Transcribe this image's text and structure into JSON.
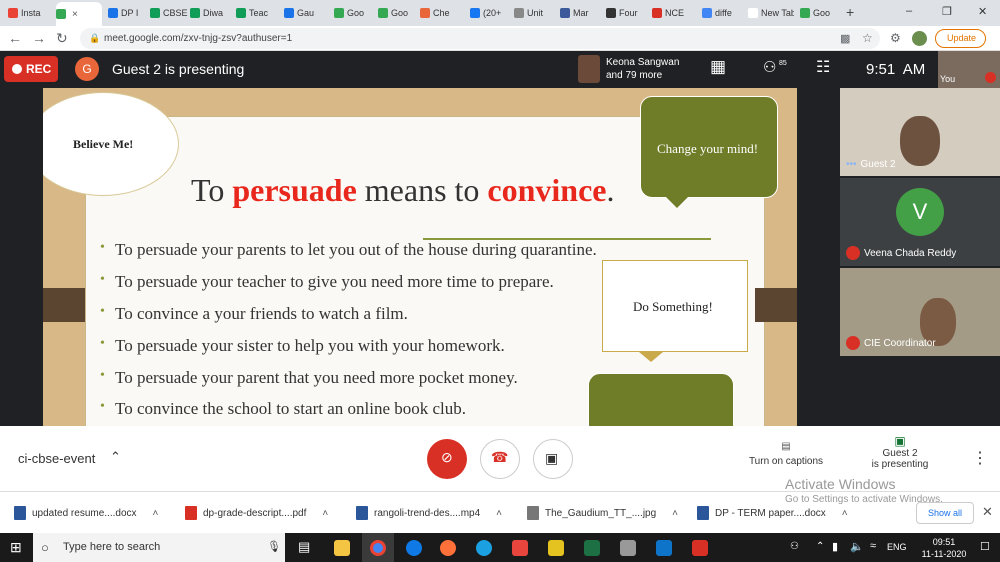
{
  "browser": {
    "tabs": [
      {
        "label": "Insta",
        "color": "#ea4335"
      },
      {
        "label": "",
        "color": "#34a853"
      },
      {
        "label": "DP I",
        "color": "#1a73e8"
      },
      {
        "label": "CBSE",
        "color": "#0f9d58"
      },
      {
        "label": "Diwa",
        "color": "#0f9d58"
      },
      {
        "label": "Teac",
        "color": "#0f9d58"
      },
      {
        "label": "Gau",
        "color": "#1a73e8"
      },
      {
        "label": "Goo",
        "color": "#34a853"
      },
      {
        "label": "Goo",
        "color": "#34a853"
      },
      {
        "label": "Che",
        "color": "#e8663a"
      },
      {
        "label": "(20+",
        "color": "#1877f2"
      },
      {
        "label": "Unit",
        "color": "#888888"
      },
      {
        "label": "Mar",
        "color": "#3c5a99"
      },
      {
        "label": "Four",
        "color": "#333333"
      },
      {
        "label": "NCE",
        "color": "#d93025"
      },
      {
        "label": "diffe",
        "color": "#4285f4"
      },
      {
        "label": "New Tab",
        "color": "#ffffff"
      },
      {
        "label": "Goo",
        "color": "#34a853"
      }
    ],
    "url": "meet.google.com/zxv-tnjg-zsv?authuser=1",
    "update_label": "Update"
  },
  "meet": {
    "rec_label": "REC",
    "presenter_initial": "G",
    "presenting_text": "Guest 2 is presenting",
    "participants_summary_line1": "Keona Sangwan",
    "participants_summary_line2": "and 79 more",
    "people_count": "85",
    "time": "9:51  AM",
    "self_label": "You"
  },
  "slide": {
    "believe": "Believe Me!",
    "change": "Change your mind!",
    "do_something": "Do Something!",
    "title_part1": "To ",
    "title_word1": "persuade",
    "title_part2": " means to ",
    "title_word2": "convince",
    "title_part3": ".",
    "bullets": [
      "To persuade your parents to let you out of  the house during quarantine.",
      "To persuade your teacher to give you need more time to prepare.",
      "To convince a your friends to watch a film.",
      "To persuade your sister to help you with your homework.",
      "To persuade your parent that you need more pocket money.",
      "To convince the school to start an online book club."
    ],
    "accent_color": "#e8281c"
  },
  "participants": [
    {
      "name": "Guest 2",
      "dots": "•••"
    },
    {
      "name": "Veena Chada Reddy",
      "initial": "V"
    },
    {
      "name": "CIE Coordinator"
    }
  ],
  "controls": {
    "meeting_name": "ci-cbse-event",
    "captions_label": "Turn on captions",
    "presenting_line1": "Guest 2",
    "presenting_line2": "is presenting"
  },
  "watermark": {
    "line1": "Activate Windows",
    "line2": "Go to Settings to activate Windows."
  },
  "downloads": [
    {
      "name": "updated resume....docx",
      "color": "#2b579a"
    },
    {
      "name": "dp-grade-descript....pdf",
      "color": "#d93025"
    },
    {
      "name": "rangoli-trend-des....mp4",
      "color": "#2b579a"
    },
    {
      "name": "The_Gaudium_TT_....jpg",
      "color": "#777777"
    },
    {
      "name": "DP - TERM paper....docx",
      "color": "#2b579a"
    }
  ],
  "show_all": "Show all",
  "taskbar": {
    "search_placeholder": "Type here to search",
    "lang": "ENG",
    "time": "09:51",
    "date": "11-11-2020"
  }
}
